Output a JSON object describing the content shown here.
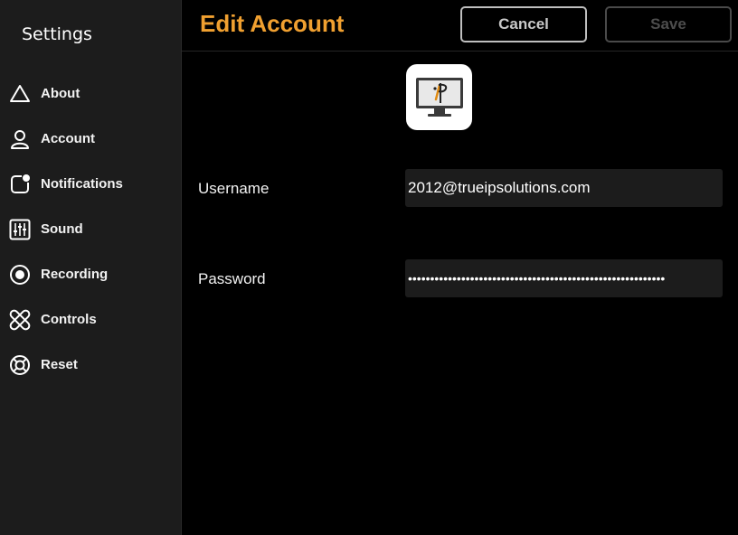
{
  "sidebar": {
    "title": "Settings",
    "items": [
      {
        "label": "About",
        "icon": "triangle-icon"
      },
      {
        "label": "Account",
        "icon": "person-icon"
      },
      {
        "label": "Notifications",
        "icon": "notification-icon"
      },
      {
        "label": "Sound",
        "icon": "sliders-icon"
      },
      {
        "label": "Recording",
        "icon": "record-icon"
      },
      {
        "label": "Controls",
        "icon": "controls-icon"
      },
      {
        "label": "Reset",
        "icon": "lifebuoy-icon"
      }
    ]
  },
  "header": {
    "title": "Edit Account",
    "cancel_label": "Cancel",
    "save_label": "Save"
  },
  "form": {
    "username_label": "Username",
    "username_value": "2012@trueipsolutions.com",
    "password_label": "Password",
    "password_value": "••••••••••••••••••••••••••••••••••••••••••••••••••••••••••"
  },
  "colors": {
    "accent": "#f0a030",
    "sidebar_bg": "#1c1c1c",
    "background": "#000000",
    "input_bg": "#1c1c1c"
  }
}
